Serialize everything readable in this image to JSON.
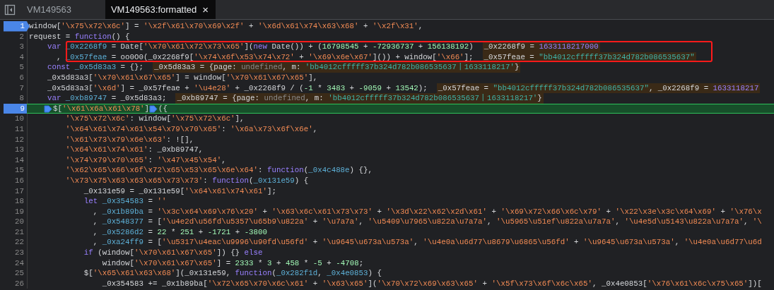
{
  "tabs": [
    {
      "label": "VM149563",
      "selected": false,
      "closable": false
    },
    {
      "label": "VM149563:formatted",
      "selected": true,
      "closable": true,
      "close_glyph": "×"
    }
  ],
  "editor": {
    "lines": [
      {
        "number": "1",
        "breakpoint": true,
        "paused": false,
        "marked": false,
        "segments": [
          {
            "kind": "plain",
            "text": "window["
          },
          {
            "kind": "string",
            "text": "'\\x75\\x72\\x6c'"
          },
          {
            "kind": "plain",
            "text": "] = "
          },
          {
            "kind": "string",
            "text": "'\\x2f\\x61\\x70\\x69\\x2f'"
          },
          {
            "kind": "plain",
            "text": " + "
          },
          {
            "kind": "string",
            "text": "'\\x6d\\x61\\x74\\x63\\x68'"
          },
          {
            "kind": "plain",
            "text": " + "
          },
          {
            "kind": "string",
            "text": "'\\x2f\\x31'"
          },
          {
            "kind": "plain",
            "text": ","
          }
        ]
      },
      {
        "number": "2",
        "breakpoint": false,
        "paused": false,
        "marked": false,
        "segments": [
          {
            "kind": "plain",
            "text": "request = "
          },
          {
            "kind": "keyword",
            "text": "function"
          },
          {
            "kind": "plain",
            "text": "() {"
          }
        ]
      },
      {
        "number": "3",
        "breakpoint": false,
        "paused": false,
        "marked": true,
        "segments": [
          {
            "kind": "keyword",
            "text": "    var "
          },
          {
            "kind": "definition",
            "text": "_0x2268f9"
          },
          {
            "kind": "plain",
            "text": " = Date["
          },
          {
            "kind": "string",
            "text": "'\\x70\\x61\\x72\\x73\\x65'"
          },
          {
            "kind": "plain",
            "text": "]("
          },
          {
            "kind": "keyword",
            "text": "new"
          },
          {
            "kind": "plain",
            "text": " Date()) + ("
          },
          {
            "kind": "number",
            "text": "16798545"
          },
          {
            "kind": "plain",
            "text": " + "
          },
          {
            "kind": "number",
            "text": "-72936737"
          },
          {
            "kind": "plain",
            "text": " + "
          },
          {
            "kind": "number",
            "text": "156138192"
          },
          {
            "kind": "plain",
            "text": ")"
          }
        ],
        "inline_value": [
          {
            "kind": "plain",
            "text": "_0x2268f9 = "
          },
          {
            "kind": "number",
            "text": "1633118217000"
          }
        ]
      },
      {
        "number": "4",
        "breakpoint": false,
        "paused": false,
        "marked": true,
        "segments": [
          {
            "kind": "plain",
            "text": "      , "
          },
          {
            "kind": "definition",
            "text": "_0x57feae"
          },
          {
            "kind": "plain",
            "text": " = oo0O0(_0x2268f9["
          },
          {
            "kind": "string",
            "text": "'\\x74\\x6f\\x53\\x74\\x72'"
          },
          {
            "kind": "plain",
            "text": " + "
          },
          {
            "kind": "string",
            "text": "'\\x69\\x6e\\x67'"
          },
          {
            "kind": "plain",
            "text": "]()) + window["
          },
          {
            "kind": "string",
            "text": "'\\x66'"
          },
          {
            "kind": "plain",
            "text": "];"
          }
        ],
        "inline_value": [
          {
            "kind": "plain",
            "text": "_0x57feae = "
          },
          {
            "kind": "string",
            "text": "\"bb4012cfffff37b324d782b086535637\""
          }
        ]
      },
      {
        "number": "5",
        "breakpoint": false,
        "paused": false,
        "marked": false,
        "segments": [
          {
            "kind": "keyword",
            "text": "    const "
          },
          {
            "kind": "definition",
            "text": "_0x5d83a3"
          },
          {
            "kind": "plain",
            "text": " = {};"
          }
        ],
        "inline_value": [
          {
            "kind": "plain",
            "text": "_0x5d83a3 = {page: "
          },
          {
            "kind": "undefined",
            "text": "undefined"
          },
          {
            "kind": "plain",
            "text": ", m: "
          },
          {
            "kind": "string",
            "text": "'bb4012cfffff37b324d782b086535637丨1633118217'"
          },
          {
            "kind": "plain",
            "text": "}"
          }
        ]
      },
      {
        "number": "6",
        "breakpoint": false,
        "paused": false,
        "marked": false,
        "segments": [
          {
            "kind": "plain",
            "text": "    _0x5d83a3["
          },
          {
            "kind": "string",
            "text": "'\\x70\\x61\\x67\\x65'"
          },
          {
            "kind": "plain",
            "text": "] = window["
          },
          {
            "kind": "string",
            "text": "'\\x70\\x61\\x67\\x65'"
          },
          {
            "kind": "plain",
            "text": "],"
          }
        ]
      },
      {
        "number": "7",
        "breakpoint": false,
        "paused": false,
        "marked": false,
        "segments": [
          {
            "kind": "plain",
            "text": "    _0x5d83a3["
          },
          {
            "kind": "string",
            "text": "'\\x6d'"
          },
          {
            "kind": "plain",
            "text": "] = _0x57feae + "
          },
          {
            "kind": "string",
            "text": "'\\u4e28'"
          },
          {
            "kind": "plain",
            "text": " + _0x2268f9 / ("
          },
          {
            "kind": "number",
            "text": "-1"
          },
          {
            "kind": "plain",
            "text": " * "
          },
          {
            "kind": "number",
            "text": "3483"
          },
          {
            "kind": "plain",
            "text": " + "
          },
          {
            "kind": "number",
            "text": "-9059"
          },
          {
            "kind": "plain",
            "text": " + "
          },
          {
            "kind": "number",
            "text": "13542"
          },
          {
            "kind": "plain",
            "text": ");"
          }
        ],
        "inline_value": [
          {
            "kind": "plain",
            "text": "_0x57feae = "
          },
          {
            "kind": "string",
            "text": "\"bb4012cfffff37b324d782b086535637\""
          },
          {
            "kind": "plain",
            "text": ", _0x2268f9 = "
          },
          {
            "kind": "number",
            "text": "1633118217"
          }
        ]
      },
      {
        "number": "8",
        "breakpoint": false,
        "paused": false,
        "marked": false,
        "segments": [
          {
            "kind": "keyword",
            "text": "    var "
          },
          {
            "kind": "definition",
            "text": "_0xb89747"
          },
          {
            "kind": "plain",
            "text": " = _0x5d83a3;"
          }
        ],
        "inline_value": [
          {
            "kind": "plain",
            "text": "_0xb89747 = {page: "
          },
          {
            "kind": "undefined",
            "text": "undefined"
          },
          {
            "kind": "plain",
            "text": ", m: "
          },
          {
            "kind": "string",
            "text": "'bb4012cfffff37b324d782b086535637丨1633118217'"
          },
          {
            "kind": "plain",
            "text": "}"
          }
        ]
      },
      {
        "number": "9",
        "breakpoint": true,
        "paused": true,
        "marked": false,
        "segments": [
          {
            "kind": "marker"
          },
          {
            "kind": "plain",
            "text": "$["
          },
          {
            "kind": "string",
            "text": "'\\x61\\x6a\\x61\\x78'"
          },
          {
            "kind": "plain",
            "text": "]"
          },
          {
            "kind": "marker"
          },
          {
            "kind": "plain",
            "text": "({"
          }
        ]
      },
      {
        "number": "10",
        "breakpoint": false,
        "paused": false,
        "marked": false,
        "segments": [
          {
            "kind": "string",
            "text": "        '\\x75\\x72\\x6c'"
          },
          {
            "kind": "plain",
            "text": ": window["
          },
          {
            "kind": "string",
            "text": "'\\x75\\x72\\x6c'"
          },
          {
            "kind": "plain",
            "text": "],"
          }
        ]
      },
      {
        "number": "11",
        "breakpoint": false,
        "paused": false,
        "marked": false,
        "segments": [
          {
            "kind": "string",
            "text": "        '\\x64\\x61\\x74\\x61\\x54\\x79\\x70\\x65'"
          },
          {
            "kind": "plain",
            "text": ": "
          },
          {
            "kind": "string",
            "text": "'\\x6a\\x73\\x6f\\x6e'"
          },
          {
            "kind": "plain",
            "text": ","
          }
        ]
      },
      {
        "number": "12",
        "breakpoint": false,
        "paused": false,
        "marked": false,
        "segments": [
          {
            "kind": "string",
            "text": "        '\\x61\\x73\\x79\\x6e\\x63'"
          },
          {
            "kind": "plain",
            "text": ": ![],"
          }
        ]
      },
      {
        "number": "13",
        "breakpoint": false,
        "paused": false,
        "marked": false,
        "segments": [
          {
            "kind": "string",
            "text": "        '\\x64\\x61\\x74\\x61'"
          },
          {
            "kind": "plain",
            "text": ": _0xb89747,"
          }
        ]
      },
      {
        "number": "14",
        "breakpoint": false,
        "paused": false,
        "marked": false,
        "segments": [
          {
            "kind": "string",
            "text": "        '\\x74\\x79\\x70\\x65'"
          },
          {
            "kind": "plain",
            "text": ": "
          },
          {
            "kind": "string",
            "text": "'\\x47\\x45\\x54'"
          },
          {
            "kind": "plain",
            "text": ","
          }
        ]
      },
      {
        "number": "15",
        "breakpoint": false,
        "paused": false,
        "marked": false,
        "segments": [
          {
            "kind": "string",
            "text": "        '\\x62\\x65\\x66\\x6f\\x72\\x65\\x53\\x65\\x6e\\x64'"
          },
          {
            "kind": "plain",
            "text": ": "
          },
          {
            "kind": "keyword",
            "text": "function"
          },
          {
            "kind": "plain",
            "text": "("
          },
          {
            "kind": "definition",
            "text": "_0x4c488e"
          },
          {
            "kind": "plain",
            "text": ") {},"
          }
        ]
      },
      {
        "number": "16",
        "breakpoint": false,
        "paused": false,
        "marked": false,
        "segments": [
          {
            "kind": "string",
            "text": "        '\\x73\\x75\\x63\\x63\\x65\\x73\\x73'"
          },
          {
            "kind": "plain",
            "text": ": "
          },
          {
            "kind": "keyword",
            "text": "function"
          },
          {
            "kind": "plain",
            "text": "("
          },
          {
            "kind": "definition",
            "text": "_0x131e59"
          },
          {
            "kind": "plain",
            "text": ") {"
          }
        ]
      },
      {
        "number": "17",
        "breakpoint": false,
        "paused": false,
        "marked": false,
        "segments": [
          {
            "kind": "plain",
            "text": "            _0x131e59 = _0x131e59["
          },
          {
            "kind": "string",
            "text": "'\\x64\\x61\\x74\\x61'"
          },
          {
            "kind": "plain",
            "text": "];"
          }
        ]
      },
      {
        "number": "18",
        "breakpoint": false,
        "paused": false,
        "marked": false,
        "segments": [
          {
            "kind": "keyword",
            "text": "            let "
          },
          {
            "kind": "definition",
            "text": "_0x354583"
          },
          {
            "kind": "plain",
            "text": " = "
          },
          {
            "kind": "string",
            "text": "''"
          }
        ]
      },
      {
        "number": "19",
        "breakpoint": false,
        "paused": false,
        "marked": false,
        "segments": [
          {
            "kind": "plain",
            "text": "              , "
          },
          {
            "kind": "definition",
            "text": "_0x1b89ba"
          },
          {
            "kind": "plain",
            "text": " = "
          },
          {
            "kind": "string",
            "text": "'\\x3c\\x64\\x69\\x76\\x20'"
          },
          {
            "kind": "plain",
            "text": " + "
          },
          {
            "kind": "string",
            "text": "'\\x63\\x6c\\x61\\x73\\x73'"
          },
          {
            "kind": "plain",
            "text": " + "
          },
          {
            "kind": "string",
            "text": "'\\x3d\\x22\\x62\\x2d\\x61'"
          },
          {
            "kind": "plain",
            "text": " + "
          },
          {
            "kind": "string",
            "text": "'\\x69\\x72\\x66\\x6c\\x79'"
          },
          {
            "kind": "plain",
            "text": " + "
          },
          {
            "kind": "string",
            "text": "'\\x22\\x3e\\x3c\\x64\\x69'"
          },
          {
            "kind": "plain",
            "text": " + "
          },
          {
            "kind": "string",
            "text": "'\\x76\\x"
          }
        ]
      },
      {
        "number": "20",
        "breakpoint": false,
        "paused": false,
        "marked": false,
        "segments": [
          {
            "kind": "plain",
            "text": "              , "
          },
          {
            "kind": "definition",
            "text": "_0x548377"
          },
          {
            "kind": "plain",
            "text": " = ["
          },
          {
            "kind": "string",
            "text": "'\\u4e2d\\u56fd\\u5357\\u65b9\\u822a'"
          },
          {
            "kind": "plain",
            "text": " + "
          },
          {
            "kind": "string",
            "text": "'\\u7a7a'"
          },
          {
            "kind": "plain",
            "text": ", "
          },
          {
            "kind": "string",
            "text": "'\\u5409\\u7965\\u822a\\u7a7a'"
          },
          {
            "kind": "plain",
            "text": ", "
          },
          {
            "kind": "string",
            "text": "'\\u5965\\u51ef\\u822a\\u7a7a'"
          },
          {
            "kind": "plain",
            "text": ", "
          },
          {
            "kind": "string",
            "text": "'\\u4e5d\\u5143\\u822a\\u7a7a'"
          },
          {
            "kind": "plain",
            "text": ", "
          },
          {
            "kind": "string",
            "text": "'\\"
          }
        ]
      },
      {
        "number": "21",
        "breakpoint": false,
        "paused": false,
        "marked": false,
        "segments": [
          {
            "kind": "plain",
            "text": "              , "
          },
          {
            "kind": "definition",
            "text": "_0x5286d2"
          },
          {
            "kind": "plain",
            "text": " = "
          },
          {
            "kind": "number",
            "text": "22"
          },
          {
            "kind": "plain",
            "text": " * "
          },
          {
            "kind": "number",
            "text": "251"
          },
          {
            "kind": "plain",
            "text": " + "
          },
          {
            "kind": "number",
            "text": "-1721"
          },
          {
            "kind": "plain",
            "text": " + "
          },
          {
            "kind": "number",
            "text": "-3800"
          }
        ]
      },
      {
        "number": "22",
        "breakpoint": false,
        "paused": false,
        "marked": false,
        "segments": [
          {
            "kind": "plain",
            "text": "              , "
          },
          {
            "kind": "definition",
            "text": "_0xa24ff9"
          },
          {
            "kind": "plain",
            "text": " = ["
          },
          {
            "kind": "string",
            "text": "'\\u5317\\u4eac\\u9996\\u90fd\\u56fd'"
          },
          {
            "kind": "plain",
            "text": " + "
          },
          {
            "kind": "string",
            "text": "'\\u9645\\u673a\\u573a'"
          },
          {
            "kind": "plain",
            "text": ", "
          },
          {
            "kind": "string",
            "text": "'\\u4e0a\\u6d77\\u8679\\u6865\\u56fd'"
          },
          {
            "kind": "plain",
            "text": " + "
          },
          {
            "kind": "string",
            "text": "'\\u9645\\u673a\\u573a'"
          },
          {
            "kind": "plain",
            "text": ", "
          },
          {
            "kind": "string",
            "text": "'\\u4e0a\\u6d77\\u6d"
          }
        ]
      },
      {
        "number": "23",
        "breakpoint": false,
        "paused": false,
        "marked": false,
        "segments": [
          {
            "kind": "keyword",
            "text": "            if"
          },
          {
            "kind": "plain",
            "text": " (window["
          },
          {
            "kind": "string",
            "text": "'\\x70\\x61\\x67\\x65'"
          },
          {
            "kind": "plain",
            "text": "]) {} "
          },
          {
            "kind": "keyword",
            "text": "else"
          }
        ]
      },
      {
        "number": "24",
        "breakpoint": false,
        "paused": false,
        "marked": false,
        "segments": [
          {
            "kind": "plain",
            "text": "                window["
          },
          {
            "kind": "string",
            "text": "'\\x70\\x61\\x67\\x65'"
          },
          {
            "kind": "plain",
            "text": "] = "
          },
          {
            "kind": "number",
            "text": "2333"
          },
          {
            "kind": "plain",
            "text": " * "
          },
          {
            "kind": "number",
            "text": "3"
          },
          {
            "kind": "plain",
            "text": " + "
          },
          {
            "kind": "number",
            "text": "458"
          },
          {
            "kind": "plain",
            "text": " * "
          },
          {
            "kind": "number",
            "text": "-5"
          },
          {
            "kind": "plain",
            "text": " + "
          },
          {
            "kind": "number",
            "text": "-4708"
          },
          {
            "kind": "plain",
            "text": ";"
          }
        ]
      },
      {
        "number": "25",
        "breakpoint": false,
        "paused": false,
        "marked": false,
        "segments": [
          {
            "kind": "plain",
            "text": "            $["
          },
          {
            "kind": "string",
            "text": "'\\x65\\x61\\x63\\x68'"
          },
          {
            "kind": "plain",
            "text": "](_0x131e59, "
          },
          {
            "kind": "keyword",
            "text": "function"
          },
          {
            "kind": "plain",
            "text": "("
          },
          {
            "kind": "definition",
            "text": "_0x282f1d"
          },
          {
            "kind": "plain",
            "text": ", "
          },
          {
            "kind": "definition",
            "text": "_0x4e0853"
          },
          {
            "kind": "plain",
            "text": ") {"
          }
        ]
      },
      {
        "number": "26",
        "breakpoint": false,
        "paused": false,
        "marked": false,
        "segments": [
          {
            "kind": "plain",
            "text": "                _0x354583 += _0x1b89ba["
          },
          {
            "kind": "string",
            "text": "'\\x72\\x65\\x70\\x6c\\x61'"
          },
          {
            "kind": "plain",
            "text": " + "
          },
          {
            "kind": "string",
            "text": "'\\x63\\x65'"
          },
          {
            "kind": "plain",
            "text": "]("
          },
          {
            "kind": "string",
            "text": "'\\x70\\x72\\x69\\x63\\x65'"
          },
          {
            "kind": "plain",
            "text": " + "
          },
          {
            "kind": "string",
            "text": "'\\x5f\\x73\\x6f\\x6c\\x65'"
          },
          {
            "kind": "plain",
            "text": ", _0x4e0853["
          },
          {
            "kind": "string",
            "text": "'\\x76\\x61\\x6c\\x75\\x65'"
          },
          {
            "kind": "plain",
            "text": "])["
          }
        ]
      }
    ]
  }
}
